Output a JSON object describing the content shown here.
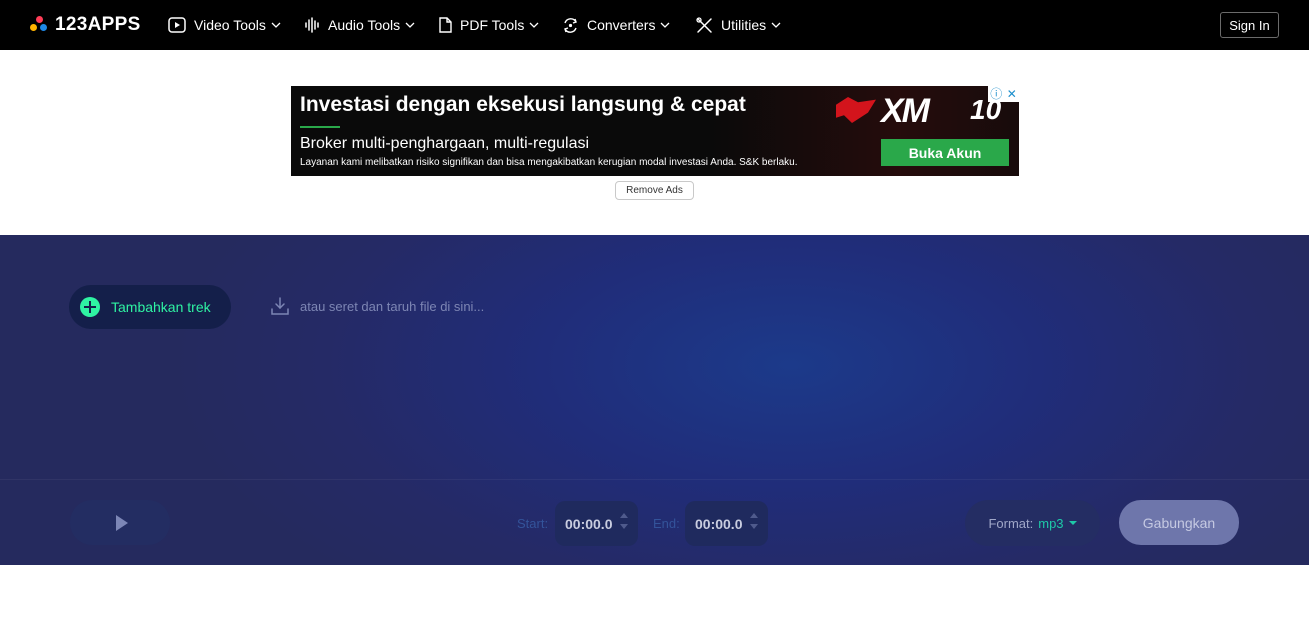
{
  "brand": {
    "name": "123APPS",
    "dot_colors": [
      "#ff3d57",
      "#ffb300",
      "#1e88e5"
    ]
  },
  "nav": {
    "items": [
      {
        "label": "Video Tools",
        "icon": "play-square-icon"
      },
      {
        "label": "Audio Tools",
        "icon": "audio-wave-icon"
      },
      {
        "label": "PDF Tools",
        "icon": "document-icon"
      },
      {
        "label": "Converters",
        "icon": "convert-cycle-icon"
      },
      {
        "label": "Utilities",
        "icon": "tools-icon"
      }
    ],
    "signin_label": "Sign In"
  },
  "ad": {
    "headline": "Investasi dengan eksekusi langsung & cepat",
    "subline": "Broker multi-penghargaan, multi-regulasi",
    "disclaimer": "Layanan kami melibatkan risiko signifikan dan bisa mengakibatkan kerugian modal investasi Anda. S&K berlaku.",
    "cta_label": "Buka Akun",
    "brand_text": "XM",
    "anniversary_text": "10",
    "accent_color": "#2aa84a"
  },
  "remove_ads_label": "Remove Ads",
  "editor": {
    "add_track_label": "Tambahkan trek",
    "drop_hint": "atau seret dan taruh file di sini...",
    "start_label": "Start:",
    "start_value": "00:00.0",
    "end_label": "End:",
    "end_value": "00:00.0",
    "format_label": "Format:",
    "format_value": "mp3",
    "merge_label": "Gabungkan",
    "accent_color": "#2ff3a3"
  }
}
